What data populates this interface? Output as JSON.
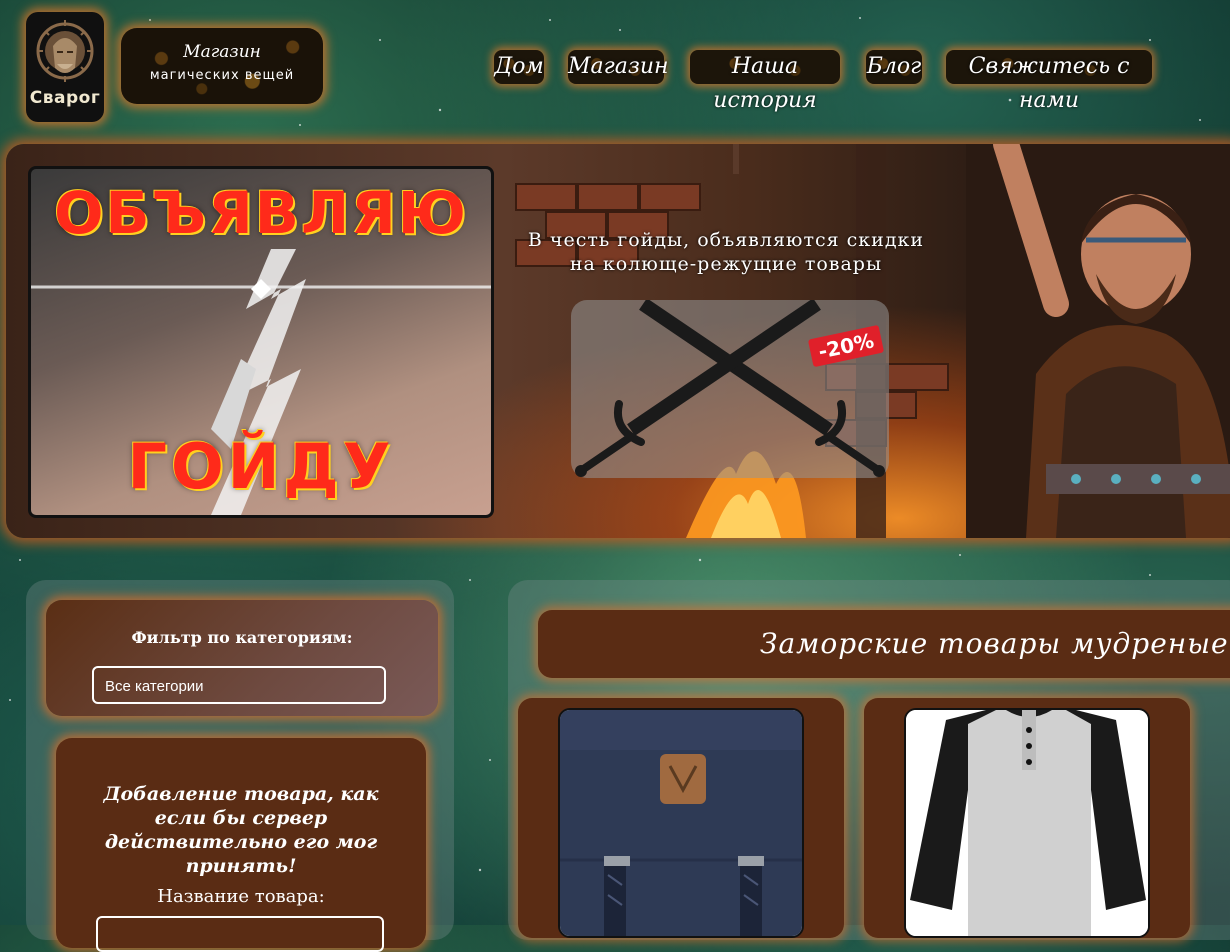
{
  "header": {
    "logo_text": "Сварог",
    "shop_title": "Магазин",
    "shop_subtitle": "магических вещей"
  },
  "nav": {
    "items": [
      {
        "label": "Дом"
      },
      {
        "label": "Магазин"
      },
      {
        "label": "Наша история"
      },
      {
        "label": "Блог"
      },
      {
        "label": "Свяжитесь с нами"
      }
    ]
  },
  "banner": {
    "poster_top": "ОБЪЯВЛЯЮ",
    "poster_bottom": "ГОЙДУ",
    "promo_text": "В честь гойды, объявляются скидки на колюще-режущие товары",
    "discount": "-20%"
  },
  "sidebar": {
    "filter_label": "Фильтр по категориям:",
    "filter_value": "Все категории",
    "add_title": "Добавление товара, как если бы сервер действительно его мог принять!",
    "name_label": "Название товара:"
  },
  "products": {
    "title": "Заморские товары мудреные. Нали",
    "items": [
      {
        "icon": "backpack-image"
      },
      {
        "icon": "shirt-image"
      }
    ]
  },
  "colors": {
    "accent_glow": "#e6782a",
    "panel_brown": "#5a2c14"
  }
}
